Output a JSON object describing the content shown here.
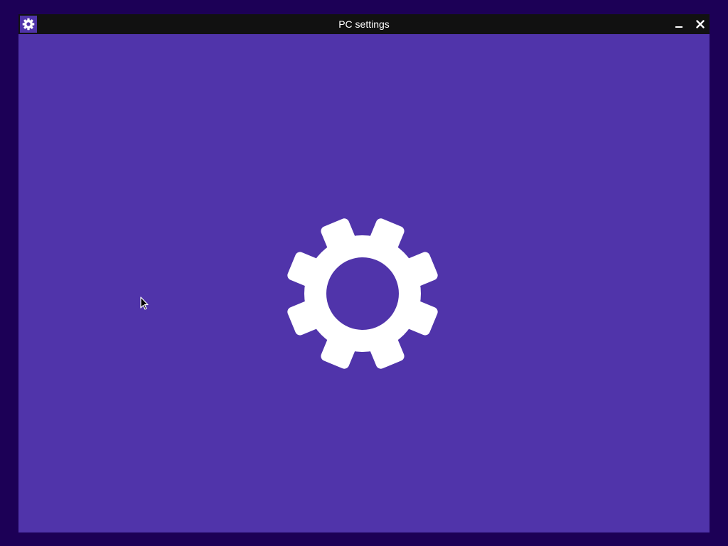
{
  "window": {
    "title": "PC settings",
    "background_color": "#5034aa",
    "titlebar_color": "#111111"
  },
  "desktop": {
    "background_color": "#1c0056"
  },
  "icons": {
    "app_icon": "gear-icon",
    "minimize": "minimize-icon",
    "close": "close-icon",
    "splash": "gear-icon",
    "cursor": "mouse-pointer-icon"
  }
}
